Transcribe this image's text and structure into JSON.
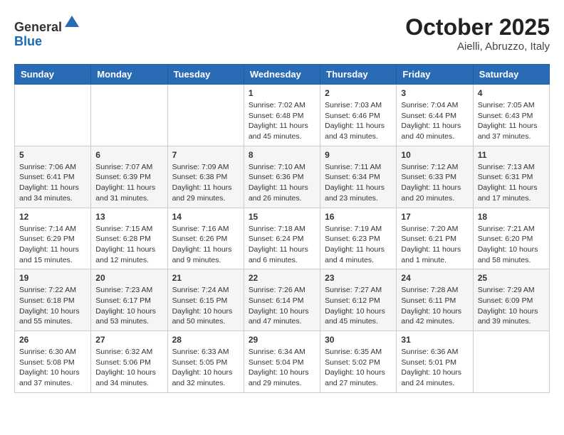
{
  "header": {
    "logo_general": "General",
    "logo_blue": "Blue",
    "title": "October 2025",
    "subtitle": "Aielli, Abruzzo, Italy"
  },
  "calendar": {
    "weekdays": [
      "Sunday",
      "Monday",
      "Tuesday",
      "Wednesday",
      "Thursday",
      "Friday",
      "Saturday"
    ],
    "weeks": [
      [
        {
          "day": "",
          "info": ""
        },
        {
          "day": "",
          "info": ""
        },
        {
          "day": "",
          "info": ""
        },
        {
          "day": "1",
          "info": "Sunrise: 7:02 AM\nSunset: 6:48 PM\nDaylight: 11 hours and 45 minutes."
        },
        {
          "day": "2",
          "info": "Sunrise: 7:03 AM\nSunset: 6:46 PM\nDaylight: 11 hours and 43 minutes."
        },
        {
          "day": "3",
          "info": "Sunrise: 7:04 AM\nSunset: 6:44 PM\nDaylight: 11 hours and 40 minutes."
        },
        {
          "day": "4",
          "info": "Sunrise: 7:05 AM\nSunset: 6:43 PM\nDaylight: 11 hours and 37 minutes."
        }
      ],
      [
        {
          "day": "5",
          "info": "Sunrise: 7:06 AM\nSunset: 6:41 PM\nDaylight: 11 hours and 34 minutes."
        },
        {
          "day": "6",
          "info": "Sunrise: 7:07 AM\nSunset: 6:39 PM\nDaylight: 11 hours and 31 minutes."
        },
        {
          "day": "7",
          "info": "Sunrise: 7:09 AM\nSunset: 6:38 PM\nDaylight: 11 hours and 29 minutes."
        },
        {
          "day": "8",
          "info": "Sunrise: 7:10 AM\nSunset: 6:36 PM\nDaylight: 11 hours and 26 minutes."
        },
        {
          "day": "9",
          "info": "Sunrise: 7:11 AM\nSunset: 6:34 PM\nDaylight: 11 hours and 23 minutes."
        },
        {
          "day": "10",
          "info": "Sunrise: 7:12 AM\nSunset: 6:33 PM\nDaylight: 11 hours and 20 minutes."
        },
        {
          "day": "11",
          "info": "Sunrise: 7:13 AM\nSunset: 6:31 PM\nDaylight: 11 hours and 17 minutes."
        }
      ],
      [
        {
          "day": "12",
          "info": "Sunrise: 7:14 AM\nSunset: 6:29 PM\nDaylight: 11 hours and 15 minutes."
        },
        {
          "day": "13",
          "info": "Sunrise: 7:15 AM\nSunset: 6:28 PM\nDaylight: 11 hours and 12 minutes."
        },
        {
          "day": "14",
          "info": "Sunrise: 7:16 AM\nSunset: 6:26 PM\nDaylight: 11 hours and 9 minutes."
        },
        {
          "day": "15",
          "info": "Sunrise: 7:18 AM\nSunset: 6:24 PM\nDaylight: 11 hours and 6 minutes."
        },
        {
          "day": "16",
          "info": "Sunrise: 7:19 AM\nSunset: 6:23 PM\nDaylight: 11 hours and 4 minutes."
        },
        {
          "day": "17",
          "info": "Sunrise: 7:20 AM\nSunset: 6:21 PM\nDaylight: 11 hours and 1 minute."
        },
        {
          "day": "18",
          "info": "Sunrise: 7:21 AM\nSunset: 6:20 PM\nDaylight: 10 hours and 58 minutes."
        }
      ],
      [
        {
          "day": "19",
          "info": "Sunrise: 7:22 AM\nSunset: 6:18 PM\nDaylight: 10 hours and 55 minutes."
        },
        {
          "day": "20",
          "info": "Sunrise: 7:23 AM\nSunset: 6:17 PM\nDaylight: 10 hours and 53 minutes."
        },
        {
          "day": "21",
          "info": "Sunrise: 7:24 AM\nSunset: 6:15 PM\nDaylight: 10 hours and 50 minutes."
        },
        {
          "day": "22",
          "info": "Sunrise: 7:26 AM\nSunset: 6:14 PM\nDaylight: 10 hours and 47 minutes."
        },
        {
          "day": "23",
          "info": "Sunrise: 7:27 AM\nSunset: 6:12 PM\nDaylight: 10 hours and 45 minutes."
        },
        {
          "day": "24",
          "info": "Sunrise: 7:28 AM\nSunset: 6:11 PM\nDaylight: 10 hours and 42 minutes."
        },
        {
          "day": "25",
          "info": "Sunrise: 7:29 AM\nSunset: 6:09 PM\nDaylight: 10 hours and 39 minutes."
        }
      ],
      [
        {
          "day": "26",
          "info": "Sunrise: 6:30 AM\nSunset: 5:08 PM\nDaylight: 10 hours and 37 minutes."
        },
        {
          "day": "27",
          "info": "Sunrise: 6:32 AM\nSunset: 5:06 PM\nDaylight: 10 hours and 34 minutes."
        },
        {
          "day": "28",
          "info": "Sunrise: 6:33 AM\nSunset: 5:05 PM\nDaylight: 10 hours and 32 minutes."
        },
        {
          "day": "29",
          "info": "Sunrise: 6:34 AM\nSunset: 5:04 PM\nDaylight: 10 hours and 29 minutes."
        },
        {
          "day": "30",
          "info": "Sunrise: 6:35 AM\nSunset: 5:02 PM\nDaylight: 10 hours and 27 minutes."
        },
        {
          "day": "31",
          "info": "Sunrise: 6:36 AM\nSunset: 5:01 PM\nDaylight: 10 hours and 24 minutes."
        },
        {
          "day": "",
          "info": ""
        }
      ]
    ]
  }
}
